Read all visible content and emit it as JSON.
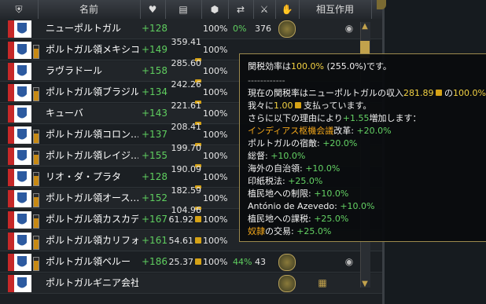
{
  "header": {
    "name": "名前",
    "interact": "相互作用",
    "icons": [
      "shield-icon",
      "heart-icon",
      "coins-icon",
      "trade-icon",
      "arrows-icon",
      "swords-icon",
      "hand-icon"
    ]
  },
  "rows": [
    {
      "name": "ニューポルトガル",
      "relation": "+128",
      "income": "",
      "pct": "100%",
      "pct2": "0%",
      "num": "376"
    },
    {
      "name": "ポルトガル領メキシコ",
      "relation": "+149",
      "income": "359.41",
      "pct": "100%",
      "pct2": "",
      "num": ""
    },
    {
      "name": "ラヴラドール",
      "relation": "+158",
      "income": "285.60",
      "pct": "100%",
      "pct2": "",
      "num": ""
    },
    {
      "name": "ポルトガル領ブラジル",
      "relation": "+134",
      "income": "242.26",
      "pct": "100%",
      "pct2": "",
      "num": ""
    },
    {
      "name": "キューバ",
      "relation": "+143",
      "income": "221.61",
      "pct": "100%",
      "pct2": "",
      "num": ""
    },
    {
      "name": "ポルトガル領コロン…",
      "relation": "+137",
      "income": "208.41",
      "pct": "100%",
      "pct2": "",
      "num": ""
    },
    {
      "name": "ポルトガル領レイジ…",
      "relation": "+155",
      "income": "199.70",
      "pct": "100%",
      "pct2": "",
      "num": ""
    },
    {
      "name": "リオ・ダ・プラタ",
      "relation": "+128",
      "income": "190.09",
      "pct": "100%",
      "pct2": "",
      "num": ""
    },
    {
      "name": "ポルトガル領オース…",
      "relation": "+152",
      "income": "182.59",
      "pct": "100%",
      "pct2": "",
      "num": ""
    },
    {
      "name": "ポルトガル領カスカデ…",
      "relation": "+167",
      "income": "61.92",
      "pct": "100%",
      "pct2": "",
      "num": ""
    },
    {
      "name": "ポルトガル領カリフォ…",
      "relation": "+161",
      "income": "54.61",
      "pct": "100%",
      "pct2": "",
      "num": ""
    },
    {
      "name": "ポルトガル領ペルー",
      "relation": "+186",
      "income": "25.37",
      "pct": "100%",
      "pct2": "44%",
      "num": "43"
    },
    {
      "name": "ポルトガルギニア会社",
      "relation": "",
      "income": "",
      "pct": "",
      "pct2": "",
      "num": ""
    }
  ],
  "income_extra": "104.96",
  "tooltip": {
    "l1a": "関税効率は",
    "l1b": "100.0%",
    "l1c": " (255.0%)です。",
    "sep": "------------",
    "l2a": "現在の関税率はニューポルトガルの収入",
    "l2b": "281.89",
    "l2c": "の",
    "l2d": "100.0%",
    "l2e": "で",
    "l3a": "我々に",
    "l3b": "1.00",
    "l3c": "支払っています。",
    "l4a": "さらに以下の理由により",
    "l4b": "+1.55",
    "l4c": "増加します：",
    "items": [
      {
        "label": "インディアス枢機会議",
        "label_color": "orange",
        "suffix": "改革: ",
        "value": "+20.0%"
      },
      {
        "label": "ポルトガルの宿敵: ",
        "label_color": "white",
        "suffix": "",
        "value": "+20.0%"
      },
      {
        "label": "総督: ",
        "label_color": "white",
        "suffix": "",
        "value": "+10.0%"
      },
      {
        "label": "海外の自治領: ",
        "label_color": "white",
        "suffix": "",
        "value": "+10.0%"
      },
      {
        "label": "印紙税法: ",
        "label_color": "white",
        "suffix": "",
        "value": "+25.0%"
      },
      {
        "label": "植民地への制限: ",
        "label_color": "white",
        "suffix": "",
        "value": "+10.0%"
      },
      {
        "label": "António de Azevedo: ",
        "label_color": "white",
        "suffix": "",
        "value": "+10.0%"
      },
      {
        "label": "植民地への課税: ",
        "label_color": "white",
        "suffix": "",
        "value": "+25.0%"
      },
      {
        "label": "奴隷",
        "label_color": "orange",
        "suffix": "の交易: ",
        "value": "+25.0%"
      }
    ]
  },
  "colors": {
    "green": "#64d264",
    "yellow": "#f2d142",
    "orange": "#f0a51a",
    "gold": "#c2a24c"
  }
}
